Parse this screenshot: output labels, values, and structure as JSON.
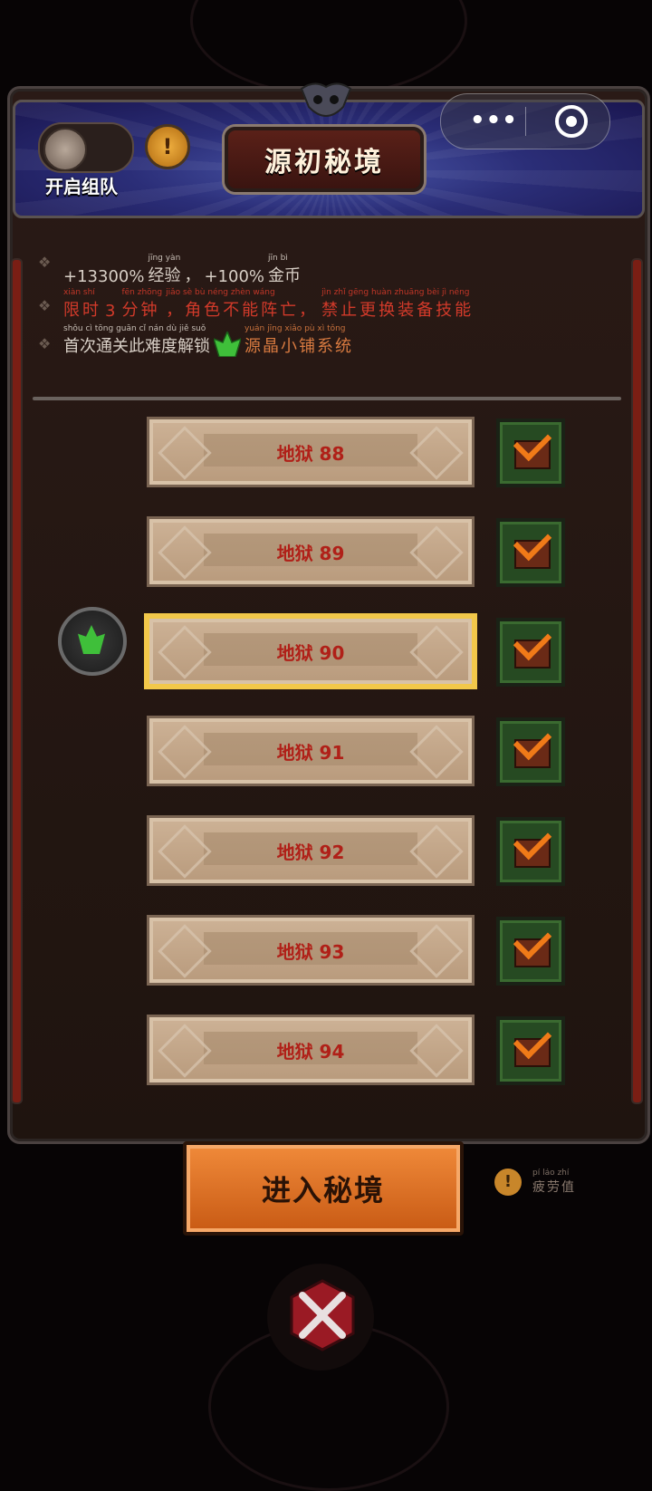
{
  "header": {
    "team_toggle_label": "开启组队",
    "info_icon": "exclamation-icon",
    "title": "源初秘境",
    "capsule": {
      "more_icon": "•••",
      "close_icon": "target-circle-icon"
    }
  },
  "info": {
    "line1": {
      "prefix": "+13300%",
      "mid": "经验",
      "mid_py": "jīng yàn",
      "comma": "，",
      "suffix": "+100%",
      "tail": "金币",
      "tail_py": "jīn bì"
    },
    "line2": {
      "a": "限时",
      "a_py": "xiàn shí",
      "num": "3",
      "b": "分钟",
      "b_py": "fēn zhōng",
      "c": "，角色不能阵亡，",
      "c_py": "jiǎo sè bù néng zhèn wáng",
      "d": "禁止更换装备技能",
      "d_py": "jìn zhǐ gēng huàn zhuāng bèi jì néng"
    },
    "line3": {
      "a": "首次通关此难度解锁",
      "a_py": "shǒu cì tōng guān cǐ nán dù jiě suǒ",
      "b": "源晶小铺系统",
      "b_py": "yuán jīng xiǎo pù xì tǒng"
    }
  },
  "levels": [
    {
      "label": "地狱 88",
      "done": true,
      "selected": false
    },
    {
      "label": "地狱 89",
      "done": true,
      "selected": false
    },
    {
      "label": "地狱 90",
      "done": true,
      "selected": true
    },
    {
      "label": "地狱 91",
      "done": true,
      "selected": false
    },
    {
      "label": "地狱 92",
      "done": true,
      "selected": false
    },
    {
      "label": "地狱 93",
      "done": true,
      "selected": false
    },
    {
      "label": "地狱 94",
      "done": true,
      "selected": false
    },
    {
      "label": "",
      "done": true,
      "selected": false
    }
  ],
  "footer": {
    "enter_button": "进入秘境",
    "fatigue_label": "疲劳值",
    "fatigue_py": "pí láo zhí"
  },
  "colors": {
    "accent_red": "#d23a2a",
    "selected_gold": "#f2c84a",
    "button_orange": "#e0741f"
  }
}
